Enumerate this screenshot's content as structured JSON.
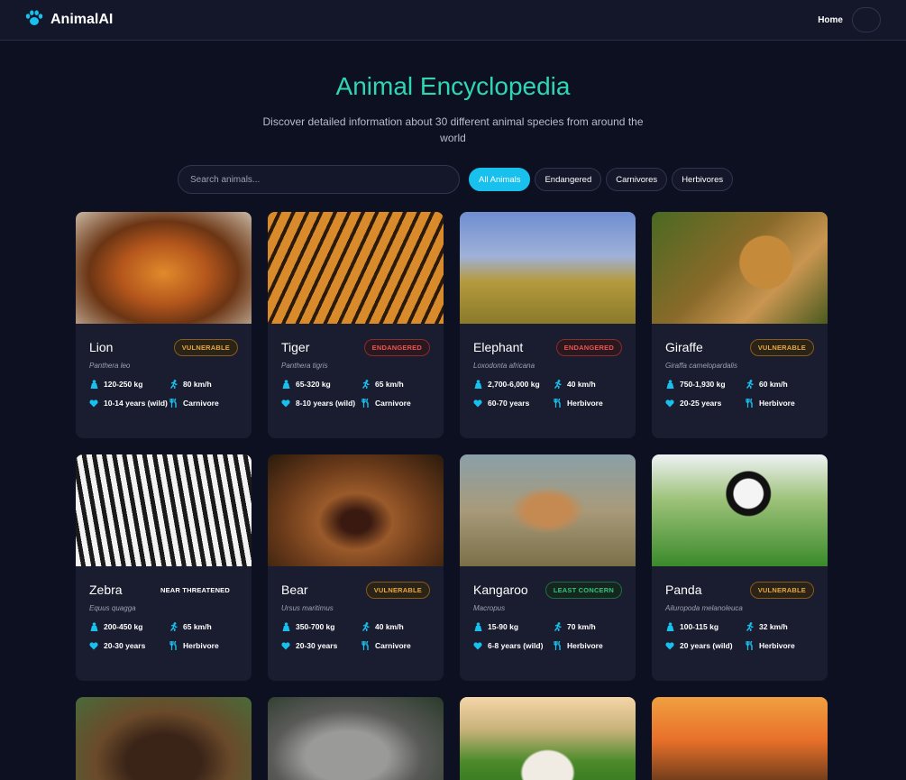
{
  "nav": {
    "brand": "AnimalAI",
    "home": "Home",
    "icons": {
      "logo": "paw-icon",
      "theme": "moon-icon"
    }
  },
  "hero": {
    "title": "Animal Encyclopedia",
    "subtitle": "Discover detailed information about 30 different animal species from around the world"
  },
  "search": {
    "placeholder": "Search animals..."
  },
  "filters": [
    "All Animals",
    "Endangered",
    "Carnivores",
    "Herbivores"
  ],
  "colors": {
    "accent": "#18c0ee",
    "title": "#2fd6b5",
    "background": "#0d1021",
    "card": "#1a1d30",
    "vulnerable": "#e9a63a",
    "endangered": "#ef5350",
    "least_concern": "#32c27a"
  },
  "animals": [
    {
      "name": "Lion",
      "status": "VULNERABLE",
      "sci": "Panthera leo",
      "weight": "120-250 kg",
      "speed": "80 km/h",
      "lifespan": "10-14 years (wild)",
      "diet": "Carnivore"
    },
    {
      "name": "Tiger",
      "status": "ENDANGERED",
      "sci": "Panthera tigris",
      "weight": "65-320 kg",
      "speed": "65 km/h",
      "lifespan": "8-10 years (wild)",
      "diet": "Carnivore"
    },
    {
      "name": "Elephant",
      "status": "ENDANGERED",
      "sci": "Loxodonta africana",
      "weight": "2,700-6,000 kg",
      "speed": "40 km/h",
      "lifespan": "60-70 years",
      "diet": "Herbivore"
    },
    {
      "name": "Giraffe",
      "status": "VULNERABLE",
      "sci": "Giraffa camelopardalis",
      "weight": "750-1,930 kg",
      "speed": "60 km/h",
      "lifespan": "20-25 years",
      "diet": "Herbivore"
    },
    {
      "name": "Zebra",
      "status": "NEAR THREATENED",
      "sci": "Equus quagga",
      "weight": "200-450 kg",
      "speed": "65 km/h",
      "lifespan": "20-30 years",
      "diet": "Herbivore"
    },
    {
      "name": "Bear",
      "status": "VULNERABLE",
      "sci": "Ursus maritimus",
      "weight": "350-700 kg",
      "speed": "40 km/h",
      "lifespan": "20-30 years",
      "diet": "Carnivore"
    },
    {
      "name": "Kangaroo",
      "status": "LEAST CONCERN",
      "sci": "Macropus",
      "weight": "15-90 kg",
      "speed": "70 km/h",
      "lifespan": "6-8 years (wild)",
      "diet": "Herbivore"
    },
    {
      "name": "Panda",
      "status": "VULNERABLE",
      "sci": "Ailuropoda melanoleuca",
      "weight": "100-115 kg",
      "speed": "32 km/h",
      "lifespan": "20 years (wild)",
      "diet": "Herbivore"
    }
  ],
  "stat_icons": {
    "weight": "weight-icon",
    "speed": "running-icon",
    "lifespan": "heart-icon",
    "diet": "utensils-icon"
  }
}
